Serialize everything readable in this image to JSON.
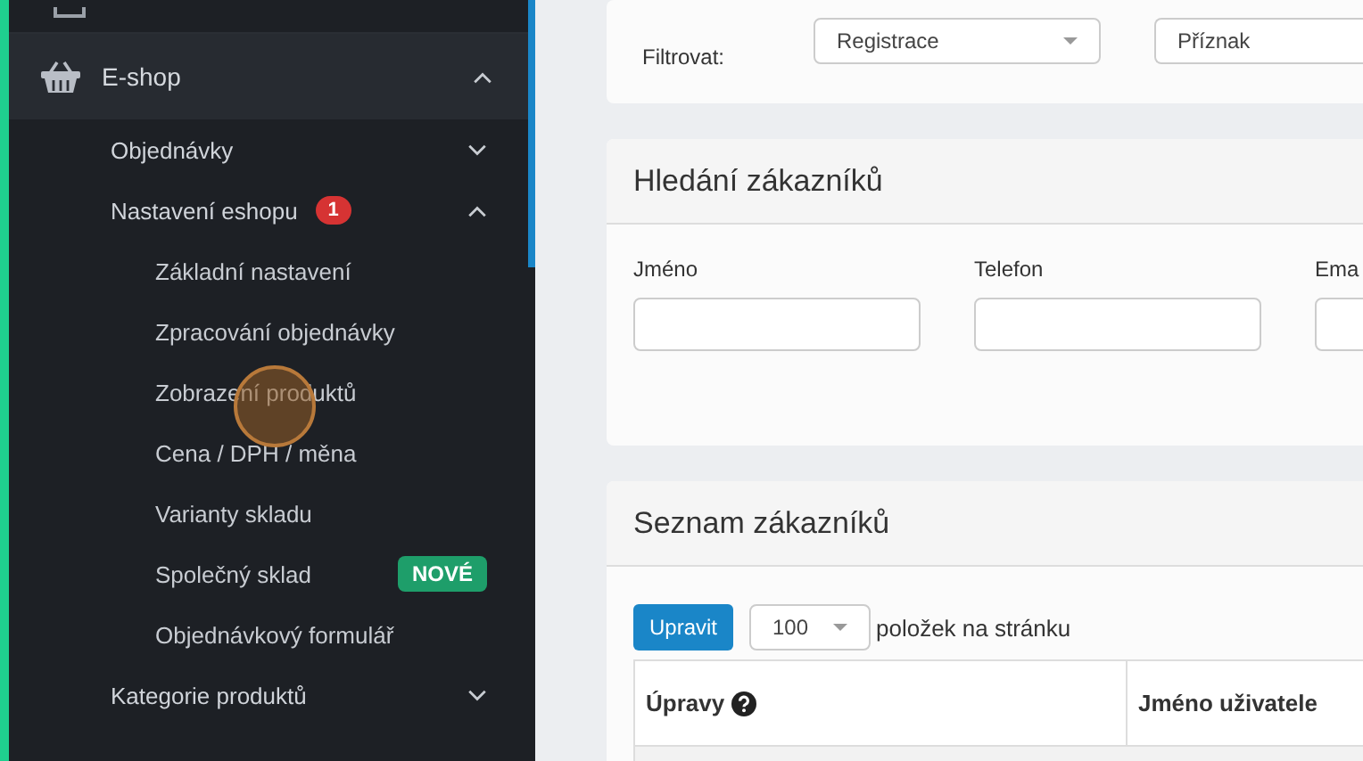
{
  "sidebar": {
    "items": [
      {
        "label": "E-shop",
        "expanded": true,
        "selected": true,
        "children": [
          {
            "label": "Objednávky",
            "expanded": false
          },
          {
            "label": "Nastavení eshopu",
            "badge": "1",
            "expanded": true,
            "children": [
              {
                "label": "Základní nastavení"
              },
              {
                "label": "Zpracování objednávky"
              },
              {
                "label": "Zobrazení produktů"
              },
              {
                "label": "Cena / DPH / měna"
              },
              {
                "label": "Varianty skladu"
              },
              {
                "label": "Společný sklad",
                "badge": "NOVÉ"
              },
              {
                "label": "Objednávkový formulář"
              }
            ]
          },
          {
            "label": "Kategorie produktů",
            "expanded": false
          }
        ]
      }
    ]
  },
  "filter": {
    "label": "Filtrovat:",
    "selects": [
      {
        "value": "Registrace"
      },
      {
        "value": "Příznak"
      }
    ]
  },
  "search": {
    "title": "Hledání zákazníků",
    "fields": [
      {
        "label": "Jméno"
      },
      {
        "label": "Telefon"
      },
      {
        "label": "Ema"
      }
    ]
  },
  "customers": {
    "title": "Seznam zákazníků",
    "edit_button": "Upravit",
    "page_size": "100",
    "page_size_label": "položek na stránku",
    "columns": [
      {
        "label": "Úpravy",
        "help": true
      },
      {
        "label": "Jméno uživatele",
        "help": false
      }
    ]
  }
}
